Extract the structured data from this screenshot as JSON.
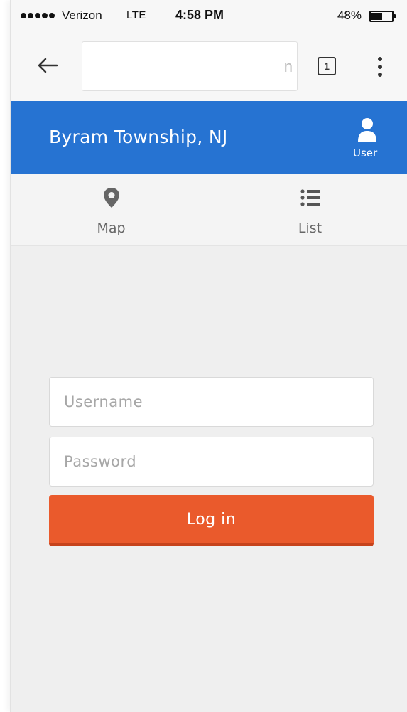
{
  "status_bar": {
    "carrier": "Verizon",
    "network": "LTE",
    "time": "4:58 PM",
    "battery": "48%"
  },
  "browser": {
    "back_icon": "arrow-left-icon",
    "url_text": "n",
    "tab_count": "1",
    "menu_icon": "more-vertical-icon"
  },
  "header": {
    "title": "Byram Township, NJ",
    "user_label": "User",
    "user_icon": "user-icon",
    "color": "#2673d2"
  },
  "nav": {
    "tabs": [
      {
        "label": "Map",
        "icon": "map-pin-icon"
      },
      {
        "label": "List",
        "icon": "list-icon"
      }
    ]
  },
  "login": {
    "username_placeholder": "Username",
    "password_placeholder": "Password",
    "button_label": "Log in",
    "button_color": "#ea5a2c"
  }
}
